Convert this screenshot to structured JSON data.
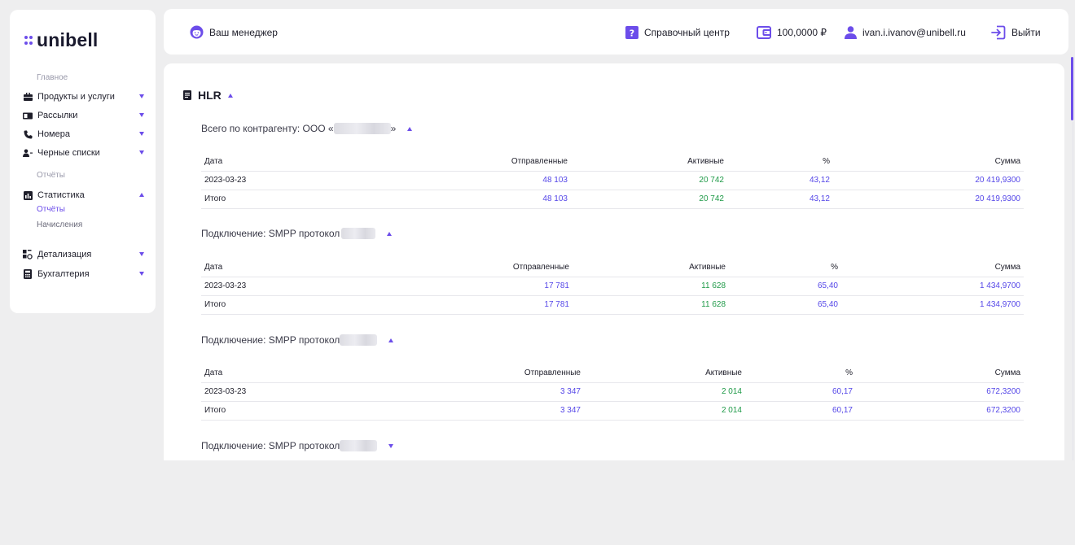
{
  "logo": {
    "text": "unibell"
  },
  "sidebar": {
    "section_main": "Главное",
    "items": [
      {
        "label": "Продукты и услуги",
        "icon": "briefcase-icon",
        "expanded": false
      },
      {
        "label": "Рассылки",
        "icon": "mailing-icon",
        "expanded": false
      },
      {
        "label": "Номера",
        "icon": "phone-icon",
        "expanded": false
      },
      {
        "label": "Черные списки",
        "icon": "user-block-icon",
        "expanded": false
      }
    ],
    "section_reports": "Отчёты",
    "stats": {
      "label": "Статистика",
      "icon": "chart-icon",
      "expanded": true
    },
    "stats_sub": [
      {
        "label": "Отчёты",
        "active": true
      },
      {
        "label": "Начисления",
        "active": false
      }
    ],
    "items2": [
      {
        "label": "Детализация",
        "icon": "detail-icon",
        "expanded": false
      },
      {
        "label": "Бухгалтерия",
        "icon": "calculator-icon",
        "expanded": false
      }
    ]
  },
  "header": {
    "manager": "Ваш менеджер",
    "help": "Справочный центр",
    "balance": "100,0000 ₽",
    "email": "ivan.i.ivanov@unibell.ru",
    "logout": "Выйти"
  },
  "report": {
    "title": "HLR",
    "columns": [
      "Дата",
      "Отправленные",
      "Активные",
      "%",
      "Сумма"
    ],
    "groups": [
      {
        "title_prefix": "Всего по контрагенту: ООО «",
        "title_suffix": "»",
        "expanded": true,
        "rows": [
          {
            "date": "2023-03-23",
            "sent": "48 103",
            "active": "20 742",
            "pct": "43,12",
            "sum": "20 419,9300"
          },
          {
            "date": "Итого",
            "sent": "48 103",
            "active": "20 742",
            "pct": "43,12",
            "sum": "20 419,9300"
          }
        ]
      },
      {
        "title_prefix": "Подключение: SMPP протокол",
        "title_suffix": "",
        "expanded": true,
        "rows": [
          {
            "date": "2023-03-23",
            "sent": "17 781",
            "active": "11 628",
            "pct": "65,40",
            "sum": "1 434,9700"
          },
          {
            "date": "Итого",
            "sent": "17 781",
            "active": "11 628",
            "pct": "65,40",
            "sum": "1 434,9700"
          }
        ]
      },
      {
        "title_prefix": "Подключение: SMPP протокол",
        "title_suffix": "",
        "expanded": true,
        "rows": [
          {
            "date": "2023-03-23",
            "sent": "3 347",
            "active": "2 014",
            "pct": "60,17",
            "sum": "672,3200"
          },
          {
            "date": "Итого",
            "sent": "3 347",
            "active": "2 014",
            "pct": "60,17",
            "sum": "672,3200"
          }
        ]
      },
      {
        "title_prefix": "Подключение: SMPP протокол",
        "title_suffix": "",
        "expanded": false
      }
    ]
  },
  "colors": {
    "accent": "#6c4dea",
    "blue_value": "#5547e8",
    "green_value": "#1f9a48"
  }
}
